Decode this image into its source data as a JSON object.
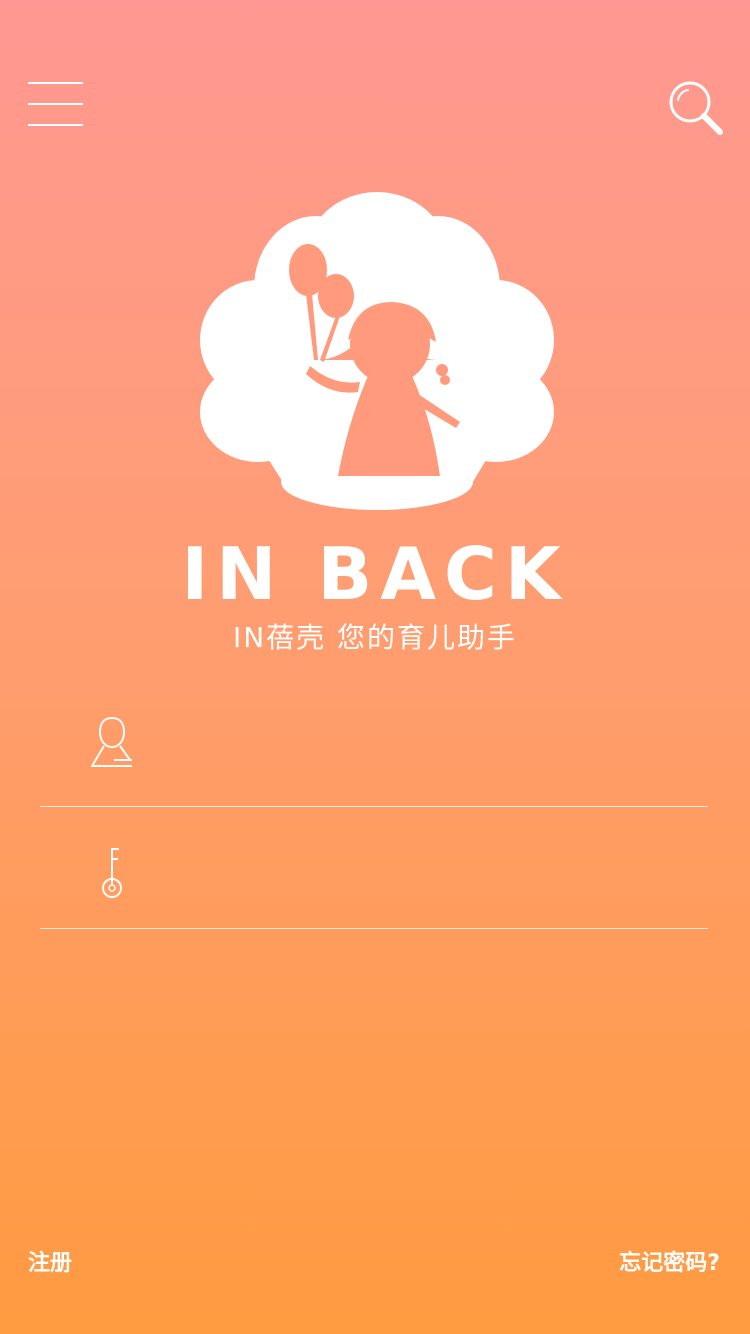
{
  "header": {
    "menu_icon": "hamburger-menu-icon",
    "search_icon": "search-icon"
  },
  "logo": {
    "icon": "shell-girl-balloon-logo",
    "brand": "IN BACK",
    "tagline": "IN蓓壳 您的育儿助手"
  },
  "form": {
    "username": {
      "icon": "user-icon",
      "value": "",
      "placeholder": ""
    },
    "password": {
      "icon": "key-icon",
      "value": "",
      "placeholder": ""
    }
  },
  "footer": {
    "register_label": "注册",
    "forgot_label": "忘记密码?"
  },
  "colors": {
    "gradient_top": "#ff9892",
    "gradient_mid": "#ff9d72",
    "gradient_bottom": "#ff9b40",
    "text": "#ffffff"
  }
}
